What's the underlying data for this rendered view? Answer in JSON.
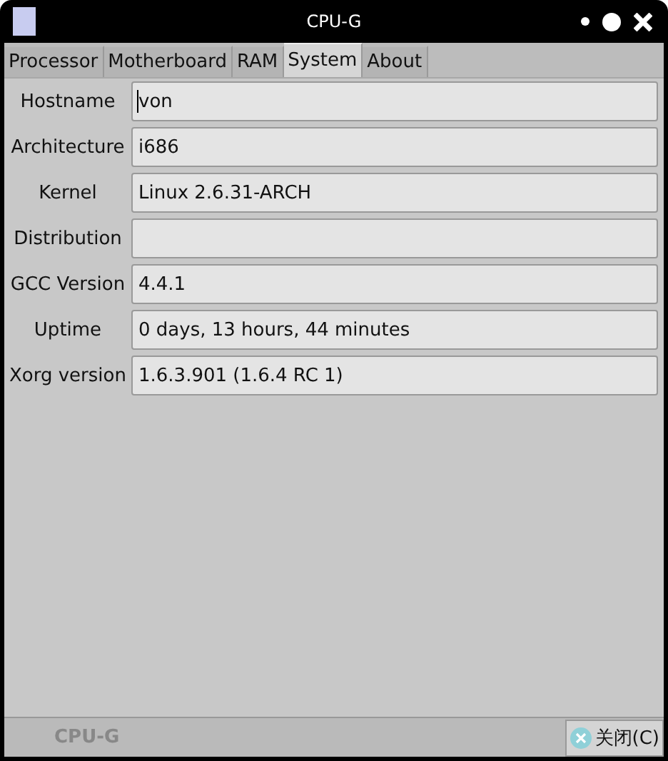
{
  "window": {
    "title": "CPU-G"
  },
  "tabs": [
    {
      "label": "Processor",
      "selected": false
    },
    {
      "label": "Motherboard",
      "selected": false
    },
    {
      "label": "RAM",
      "selected": false
    },
    {
      "label": "System",
      "selected": true
    },
    {
      "label": "About",
      "selected": false
    }
  ],
  "fields": [
    {
      "label": "Hostname",
      "value": "von",
      "focused": true
    },
    {
      "label": "Architecture",
      "value": "i686",
      "focused": false
    },
    {
      "label": "Kernel",
      "value": "Linux 2.6.31-ARCH",
      "focused": false
    },
    {
      "label": "Distribution",
      "focused": false
    },
    {
      "label": "GCC Version",
      "value": "4.4.1",
      "focused": false
    },
    {
      "label": "Uptime",
      "value": "0 days, 13 hours, 44 minutes",
      "focused": false
    },
    {
      "label": "Xorg version",
      "value": "1.6.3.901 (1.6.4 RC 1)",
      "focused": false
    }
  ],
  "status_bar": {
    "text": "CPU-G",
    "close_button": "关闭(C)"
  }
}
